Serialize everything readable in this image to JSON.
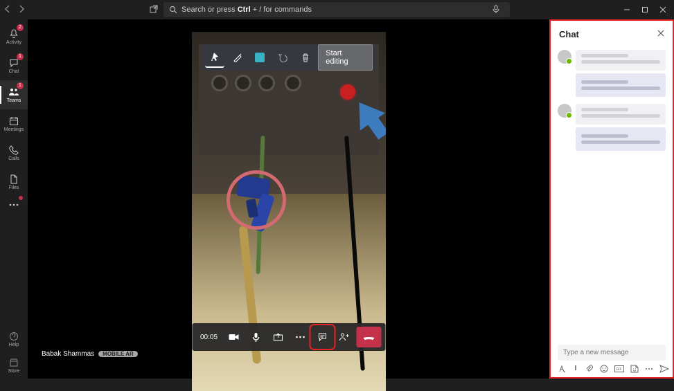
{
  "search": {
    "placeholder_pre": "Search or press ",
    "placeholder_key": "Ctrl",
    "placeholder_post": " + / for commands"
  },
  "rail": {
    "activity": "Activity",
    "chat": "Chat",
    "teams": "Teams",
    "meetings": "Meetings",
    "calls": "Calls",
    "files": "Files",
    "help": "Help",
    "store": "Store",
    "badges": {
      "activity": "2",
      "chat": "1",
      "teams": "1"
    }
  },
  "annotation": {
    "start_editing": "Start editing",
    "color": "#38b2c4"
  },
  "call": {
    "duration": "00:05",
    "participant_name": "Babak Shammas",
    "participant_tag": "MOBILE AR"
  },
  "chat": {
    "header": "Chat",
    "compose_placeholder": "Type a new message"
  }
}
